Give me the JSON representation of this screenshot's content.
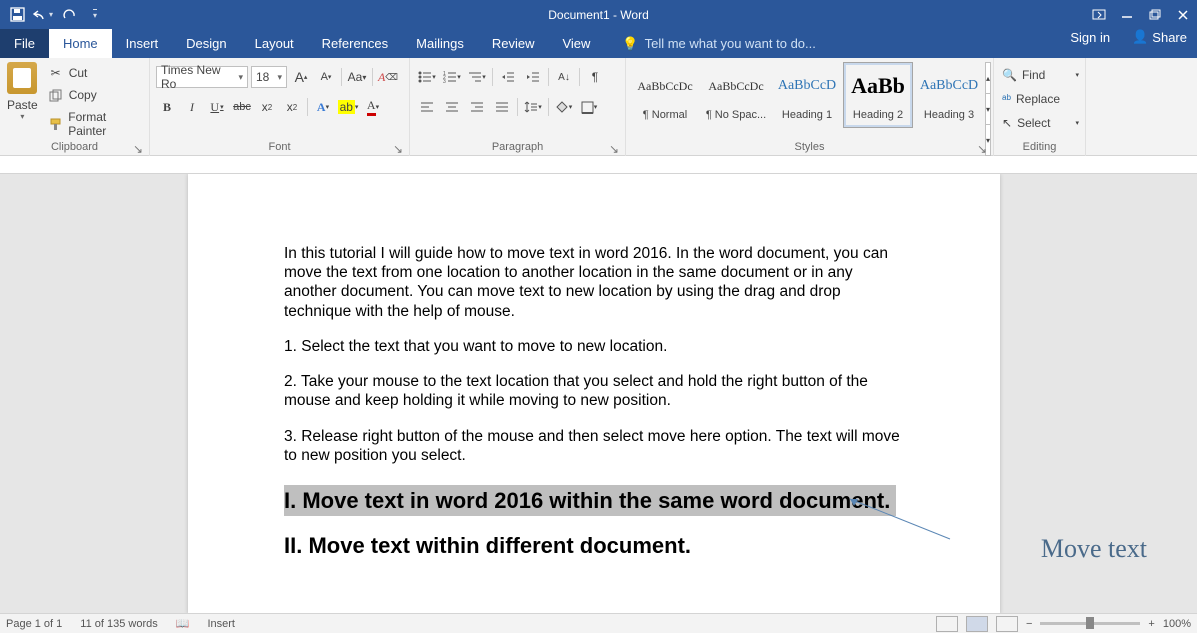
{
  "title": "Document1 - Word",
  "qa": {
    "save": "save",
    "undo": "undo",
    "redo": "redo"
  },
  "winctrl": {
    "ribbonopts": "ribbon-options",
    "min": "minimize",
    "max": "restore",
    "close": "close"
  },
  "tabs": {
    "file": "File",
    "home": "Home",
    "insert": "Insert",
    "design": "Design",
    "layout": "Layout",
    "references": "References",
    "mailings": "Mailings",
    "review": "Review",
    "view": "View"
  },
  "tellme": "Tell me what you want to do...",
  "signin": "Sign in",
  "share": "Share",
  "clipboard": {
    "paste": "Paste",
    "cut": "Cut",
    "copy": "Copy",
    "format_painter": "Format Painter",
    "label": "Clipboard"
  },
  "font": {
    "name": "Times New Ro",
    "size": "18",
    "grow": "A",
    "shrink": "A",
    "case": "Aa",
    "clear": "clear",
    "b": "B",
    "i": "I",
    "u": "U",
    "strike": "abc",
    "sub": "x",
    "sup": "x",
    "effects": "A",
    "highlight": "ab",
    "color": "A",
    "label": "Font"
  },
  "para": {
    "label": "Paragraph"
  },
  "styles": {
    "tiles": [
      {
        "preview": "AaBbCcDc",
        "label": "¶ Normal",
        "style": "font-size:12px;color:#333"
      },
      {
        "preview": "AaBbCcDc",
        "label": "¶ No Spac...",
        "style": "font-size:12px;color:#333"
      },
      {
        "preview": "AaBbCcD",
        "label": "Heading 1",
        "style": "font-size:14px;color:#2e74b5"
      },
      {
        "preview": "AaBb",
        "label": "Heading 2",
        "style": "font-size:22px;color:#000;font-weight:bold"
      },
      {
        "preview": "AaBbCcD",
        "label": "Heading 3",
        "style": "font-size:14px;color:#2e74b5"
      }
    ],
    "label": "Styles",
    "selected": 3
  },
  "editing": {
    "find": "Find",
    "replace": "Replace",
    "select": "Select",
    "label": "Editing"
  },
  "doc": {
    "p1": "In this tutorial I will guide how to move text in word 2016. In the word document, you can move the text from one location to another location in the same document or in any another document. You can move text to new location by using the drag and drop technique with the help of mouse.",
    "p2": "1. Select the text that you want to move to new location.",
    "p3": "2. Take your mouse to the text location that you select and hold the right button of the mouse and keep holding it while moving to new position.",
    "p4": "3. Release right button of the mouse and then select move here option. The text will move to new position you select.",
    "h1": "I. Move text in word 2016 within the same word document.",
    "h2": "II. Move text within different document.",
    "annotation": "Move text"
  },
  "status": {
    "page": "Page 1 of 1",
    "words": "11 of 135 words",
    "insert": "Insert",
    "zoom": "100%"
  }
}
